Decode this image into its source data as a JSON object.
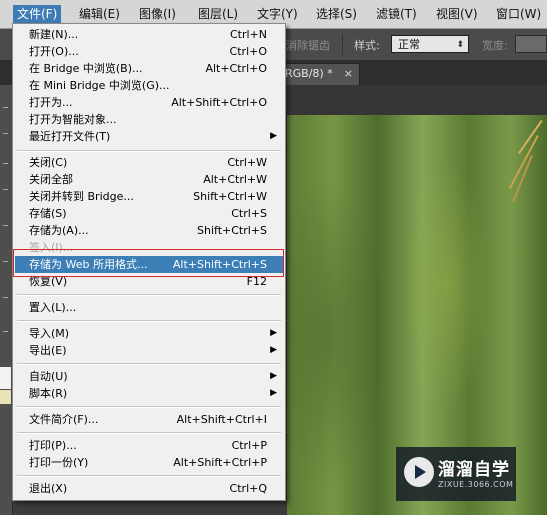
{
  "menubar": {
    "items": [
      {
        "label": "文件(F)",
        "active": true
      },
      {
        "label": "编辑(E)"
      },
      {
        "label": "图像(I)"
      },
      {
        "label": "图层(L)"
      },
      {
        "label": "文字(Y)"
      },
      {
        "label": "选择(S)"
      },
      {
        "label": "滤镜(T)"
      },
      {
        "label": "视图(V)"
      },
      {
        "label": "窗口(W)"
      }
    ]
  },
  "optionsbar": {
    "antialias_label": "消除锯齿",
    "style_label": "样式:",
    "style_value": "正常",
    "width_label": "宽度:"
  },
  "document_tab": {
    "title": "RGB/8) *",
    "close_glyph": "×"
  },
  "file_menu": {
    "items": [
      {
        "label": "新建(N)...",
        "shortcut": "Ctrl+N"
      },
      {
        "label": "打开(O)...",
        "shortcut": "Ctrl+O"
      },
      {
        "label": "在 Bridge 中浏览(B)...",
        "shortcut": "Alt+Ctrl+O"
      },
      {
        "label": "在 Mini Bridge 中浏览(G)...",
        "shortcut": ""
      },
      {
        "label": "打开为...",
        "shortcut": "Alt+Shift+Ctrl+O"
      },
      {
        "label": "打开为智能对象...",
        "shortcut": ""
      },
      {
        "label": "最近打开文件(T)",
        "shortcut": "",
        "submenu": "▶"
      },
      {
        "label": "关闭(C)",
        "shortcut": "Ctrl+W"
      },
      {
        "label": "关闭全部",
        "shortcut": "Alt+Ctrl+W"
      },
      {
        "label": "关闭并转到 Bridge...",
        "shortcut": "Shift+Ctrl+W"
      },
      {
        "label": "存储(S)",
        "shortcut": "Ctrl+S"
      },
      {
        "label": "存储为(A)...",
        "shortcut": "Shift+Ctrl+S"
      },
      {
        "label": "签入(I)...",
        "shortcut": "",
        "disabled": true
      },
      {
        "label": "存储为 Web 所用格式...",
        "shortcut": "Alt+Shift+Ctrl+S",
        "highlight": true
      },
      {
        "label": "恢复(V)",
        "shortcut": "F12"
      },
      {
        "label": "置入(L)...",
        "shortcut": ""
      },
      {
        "label": "导入(M)",
        "shortcut": "",
        "submenu": "▶"
      },
      {
        "label": "导出(E)",
        "shortcut": "",
        "submenu": "▶"
      },
      {
        "label": "自动(U)",
        "shortcut": "",
        "submenu": "▶"
      },
      {
        "label": "脚本(R)",
        "shortcut": "",
        "submenu": "▶"
      },
      {
        "label": "文件简介(F)...",
        "shortcut": "Alt+Shift+Ctrl+I"
      },
      {
        "label": "打印(P)...",
        "shortcut": "Ctrl+P"
      },
      {
        "label": "打印一份(Y)",
        "shortcut": "Alt+Shift+Ctrl+P"
      },
      {
        "label": "退出(X)",
        "shortcut": "Ctrl+Q"
      }
    ]
  },
  "watermark": {
    "name": "溜溜自学",
    "url": "ZIXUE.3066.COM"
  }
}
